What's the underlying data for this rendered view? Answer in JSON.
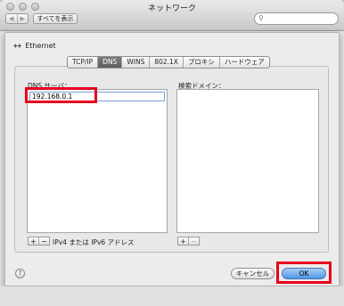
{
  "window": {
    "title": "ネットワーク"
  },
  "toolbar": {
    "back_icon": "◀",
    "forward_icon": "▶",
    "show_all_label": "すべてを表示",
    "search_placeholder": ""
  },
  "sheet": {
    "interface_name": "Ethernet",
    "tabs": [
      {
        "label": "TCP/IP",
        "active": false
      },
      {
        "label": "DNS",
        "active": true
      },
      {
        "label": "WINS",
        "active": false
      },
      {
        "label": "802.1X",
        "active": false
      },
      {
        "label": "プロキシ",
        "active": false
      },
      {
        "label": "ハードウェア",
        "active": false
      }
    ],
    "dns_servers_label": "DNS サーバ：",
    "dns_servers": [
      "192.168.0.1"
    ],
    "dns_hint": "IPv4 または IPv6 アドレス",
    "search_domains_label": "検索ドメイン：",
    "search_domains": [],
    "add_label": "+",
    "remove_label": "−",
    "help_label": "?",
    "cancel_label": "キャンセル",
    "ok_label": "OK"
  },
  "colors": {
    "highlight_box": "#e8001c",
    "default_button": "#4f97e4"
  }
}
